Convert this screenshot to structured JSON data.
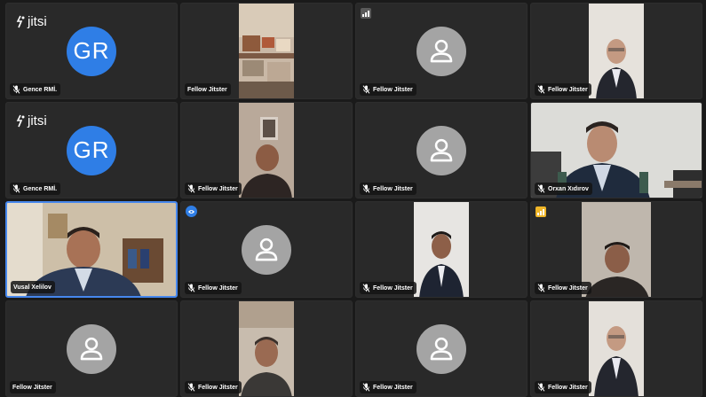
{
  "app": {
    "logo_text": "jitsi"
  },
  "participants": [
    {
      "name": "Gence RMİ.",
      "initials": "GR",
      "type": "initials",
      "muted": true
    },
    {
      "name": "Fellow Jitster",
      "type": "video",
      "muted": false
    },
    {
      "name": "Fellow Jitster",
      "type": "avatar",
      "muted": true,
      "indicator": "connection-gray"
    },
    {
      "name": "Fellow Jitster",
      "type": "video",
      "muted": true
    },
    {
      "name": "Gence RMİ.",
      "initials": "GR",
      "type": "initials",
      "muted": true
    },
    {
      "name": "Fellow Jitster",
      "type": "video",
      "muted": true
    },
    {
      "name": "Fellow Jitster",
      "type": "avatar",
      "muted": true
    },
    {
      "name": "Orxan Xıdırov",
      "type": "video",
      "muted": true
    },
    {
      "name": "Vusal Xelilov",
      "type": "video",
      "muted": false,
      "active_speaker": true
    },
    {
      "name": "Fellow Jitster",
      "type": "avatar",
      "muted": true,
      "indicator": "status-blue"
    },
    {
      "name": "Fellow Jitster",
      "type": "video",
      "muted": true
    },
    {
      "name": "Fellow Jitster",
      "type": "video",
      "muted": true,
      "indicator": "connection-yellow"
    },
    {
      "name": "Fellow Jitster",
      "type": "avatar",
      "muted": false
    },
    {
      "name": "Fellow Jitster",
      "type": "video",
      "muted": true
    },
    {
      "name": "Fellow Jitster",
      "type": "avatar",
      "muted": true
    },
    {
      "name": "Fellow Jitster",
      "type": "video",
      "muted": true
    }
  ],
  "colors": {
    "background": "#1a1a1a",
    "tile": "#292929",
    "active_border": "#4687ed",
    "initials_avatar": "#2f7ee6",
    "generic_avatar": "#a4a4a4",
    "connection_warning": "#f0b628"
  }
}
